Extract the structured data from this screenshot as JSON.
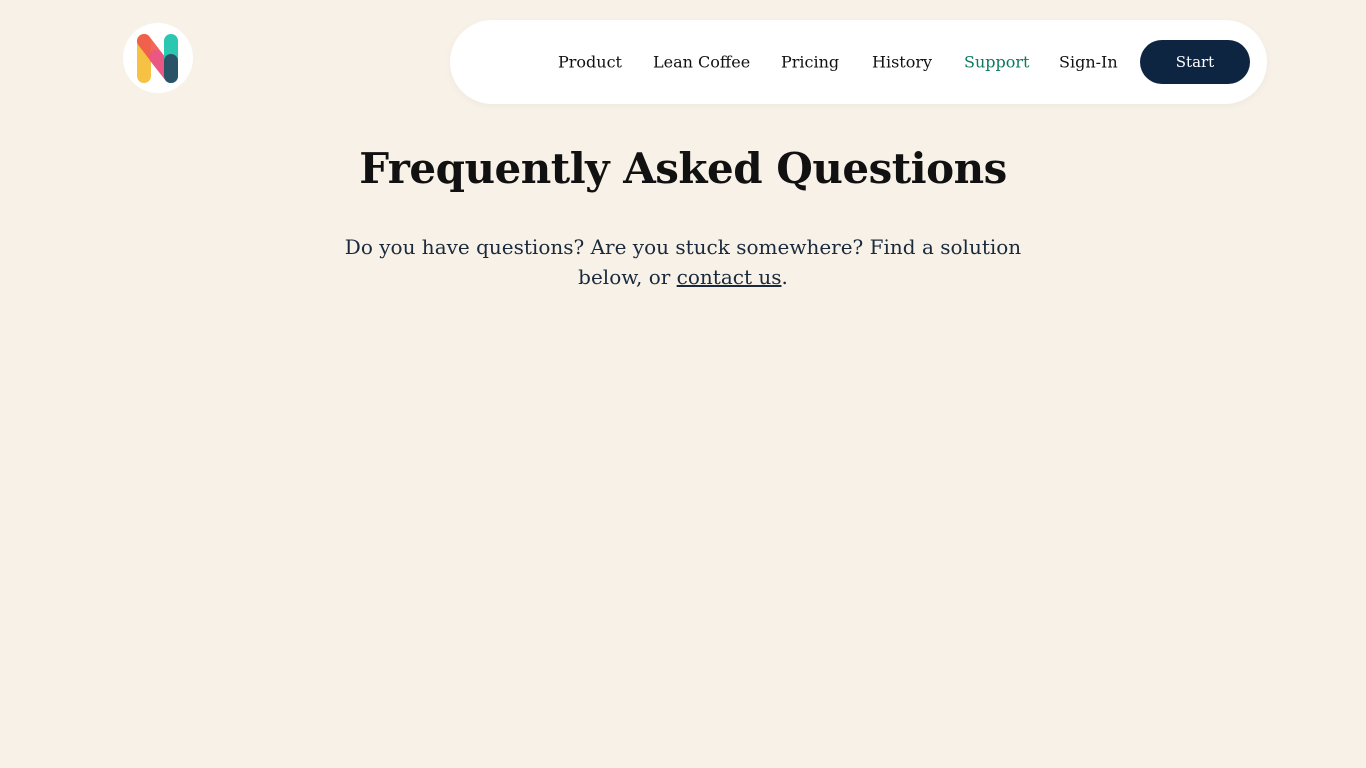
{
  "brand": {
    "logo_icon": "n-letter-logo-icon",
    "colors": {
      "yellow": "#f6c244",
      "red": "#f0574c",
      "pink": "#e9558a",
      "teal": "#2cc7b0",
      "navy": "#2a3f5c"
    }
  },
  "nav": {
    "items": [
      {
        "label": "Product"
      },
      {
        "label": "Lean Coffee"
      },
      {
        "label": "Pricing"
      },
      {
        "label": "History"
      },
      {
        "label": "Support",
        "active": true
      },
      {
        "label": "Sign-In"
      }
    ],
    "cta_label": "Start"
  },
  "hero": {
    "title": "Frequently Asked Questions",
    "subtitle_before": "Do you have questions? Are you stuck somewhere? Find a solution below, or ",
    "subtitle_link": "contact us",
    "subtitle_after": "."
  },
  "colors": {
    "background": "#f8f1e7",
    "active_nav": "#0b7a5c",
    "cta_background": "#0e2541"
  }
}
